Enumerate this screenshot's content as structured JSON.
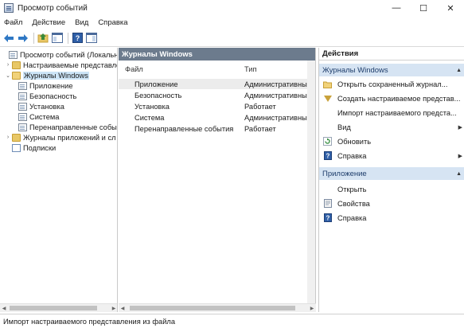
{
  "window": {
    "title": "Просмотр событий",
    "icon": "event-viewer-icon",
    "controls": [
      "—",
      "☐",
      "✕"
    ]
  },
  "menu": [
    "Файл",
    "Действие",
    "Вид",
    "Справка"
  ],
  "toolbar": {
    "buttons": [
      "back-arrow-icon",
      "forward-arrow-icon",
      "folder-up-icon",
      "console-tree-icon",
      "help-icon",
      "show-pane-icon"
    ]
  },
  "tree": {
    "items": [
      {
        "label": "Просмотр событий (Локальн",
        "arrow": "",
        "icon": "log-icon"
      },
      {
        "label": "Настраиваемые представле",
        "arrow": "›",
        "icon": "folder-icon"
      },
      {
        "label": "Журналы Windows",
        "arrow": "⌄",
        "icon": "folder-open-icon"
      },
      {
        "label": "Приложение",
        "arrow": "",
        "icon": "log-icon"
      },
      {
        "label": "Безопасность",
        "arrow": "",
        "icon": "log-icon"
      },
      {
        "label": "Установка",
        "arrow": "",
        "icon": "log-icon"
      },
      {
        "label": "Система",
        "arrow": "",
        "icon": "log-icon"
      },
      {
        "label": "Перенаправленные собы",
        "arrow": "",
        "icon": "log-icon"
      },
      {
        "label": "Журналы приложений и сл",
        "arrow": "›",
        "icon": "folder-icon"
      },
      {
        "label": "Подписки",
        "arrow": "",
        "icon": "subscription-icon"
      }
    ]
  },
  "center": {
    "header": "Журналы Windows",
    "columns": [
      "Файл",
      "Тип"
    ],
    "rows": [
      {
        "name": "Приложение",
        "type": "Административный"
      },
      {
        "name": "Безопасность",
        "type": "Административный"
      },
      {
        "name": "Установка",
        "type": "Работает"
      },
      {
        "name": "Система",
        "type": "Административный"
      },
      {
        "name": "Перенаправленные события",
        "type": "Работает"
      }
    ]
  },
  "actions": {
    "header": "Действия",
    "section1": {
      "title": "Журналы Windows",
      "items": [
        {
          "label": "Открыть сохраненный журнал...",
          "icon": "open-folder-icon"
        },
        {
          "label": "Создать настраиваемое представ...",
          "icon": "filter-icon"
        },
        {
          "label": "Импорт настраиваемого предста...",
          "icon": ""
        },
        {
          "label": "Вид",
          "icon": "",
          "submenu": "▶"
        },
        {
          "label": "Обновить",
          "icon": "refresh-icon"
        },
        {
          "label": "Справка",
          "icon": "help-icon",
          "submenu": "▶"
        }
      ]
    },
    "section2": {
      "title": "Приложение",
      "items": [
        {
          "label": "Открыть",
          "icon": ""
        },
        {
          "label": "Свойства",
          "icon": "properties-icon"
        },
        {
          "label": "Справка",
          "icon": "help-icon"
        }
      ]
    }
  },
  "status": "Импорт настраиваемого представления из файла"
}
